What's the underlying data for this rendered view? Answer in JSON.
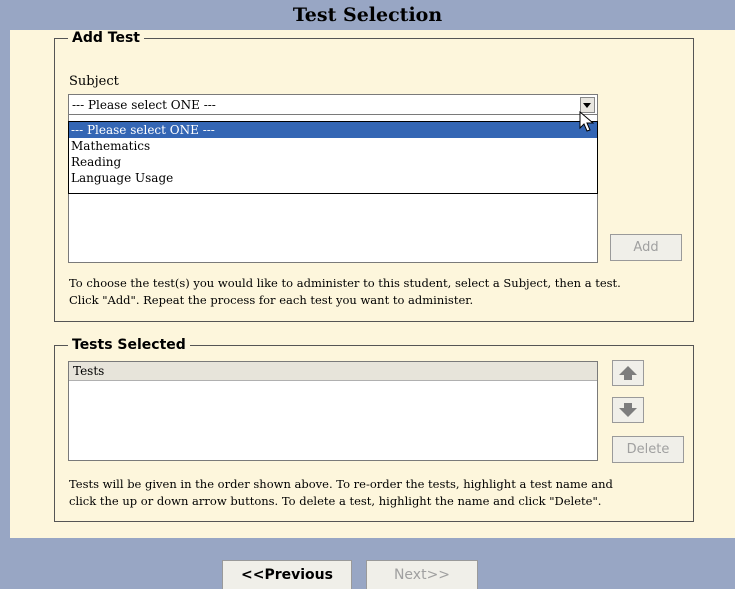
{
  "page": {
    "title": "Test Selection"
  },
  "add_test": {
    "legend": "Add Test",
    "subject_label": "Subject",
    "subject_value": "--- Please select ONE ---",
    "options": [
      "--- Please select ONE ---",
      "Mathematics",
      "Reading",
      "Language Usage"
    ],
    "add_label": "Add",
    "help_line1": "To choose the test(s) you would like to administer to this student, select a Subject, then a test.",
    "help_line2": "Click \"Add\".  Repeat the process for each test you want to administer."
  },
  "tests_selected": {
    "legend": "Tests Selected",
    "column_header": "Tests",
    "delete_label": "Delete",
    "help_line1": "Tests will be given in the order shown above.  To re-order the tests, highlight a test name and",
    "help_line2": "click the up or down arrow buttons.  To delete a test, highlight the name and click \"Delete\"."
  },
  "footer": {
    "previous_label": "<<Previous",
    "next_label": "Next>>"
  },
  "colors": {
    "frame": "#98a6c4",
    "panel": "#fdf6dc",
    "selection": "#3466b4"
  }
}
